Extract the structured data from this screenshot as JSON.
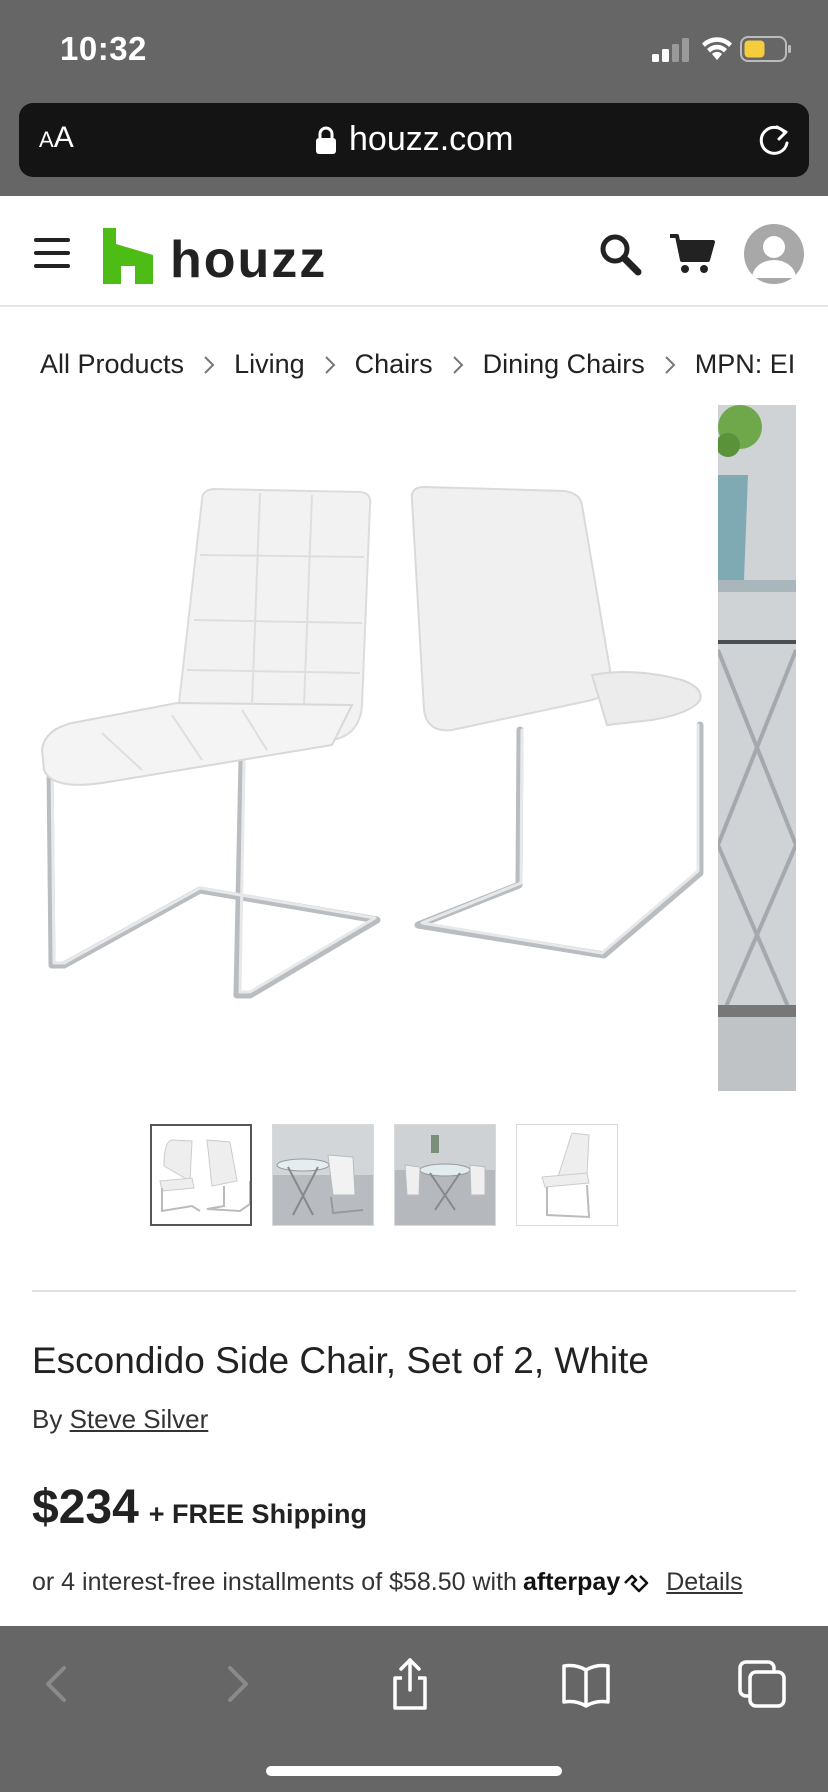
{
  "status_bar": {
    "time": "10:32"
  },
  "browser": {
    "text_size_label_small": "A",
    "text_size_label_large": "A",
    "url": "houzz.com"
  },
  "site": {
    "brand_name": "houzz",
    "brand_color": "#4DBC15"
  },
  "breadcrumb": [
    {
      "label": "All Products"
    },
    {
      "label": "Living"
    },
    {
      "label": "Chairs"
    },
    {
      "label": "Dining Chairs"
    },
    {
      "label": "MPN: EI"
    }
  ],
  "gallery": {
    "thumbnail_count": 4,
    "active_thumbnail": 1
  },
  "product": {
    "title": "Escondido Side Chair, Set of 2, White",
    "by_prefix": "By",
    "brand": "Steve Silver",
    "price": "$234",
    "shipping": "+ FREE Shipping",
    "installments_text": "or 4 interest-free installments of $58.50 with",
    "afterpay_label": "afterpay",
    "details_label": "Details"
  },
  "icons": {
    "menu": "hamburger-icon",
    "search": "search-icon",
    "cart": "cart-icon",
    "account": "user-avatar-icon",
    "back": "chevron-left-icon",
    "forward": "chevron-right-icon",
    "share": "share-icon",
    "bookmarks": "book-icon",
    "tabs": "tabs-icon"
  }
}
